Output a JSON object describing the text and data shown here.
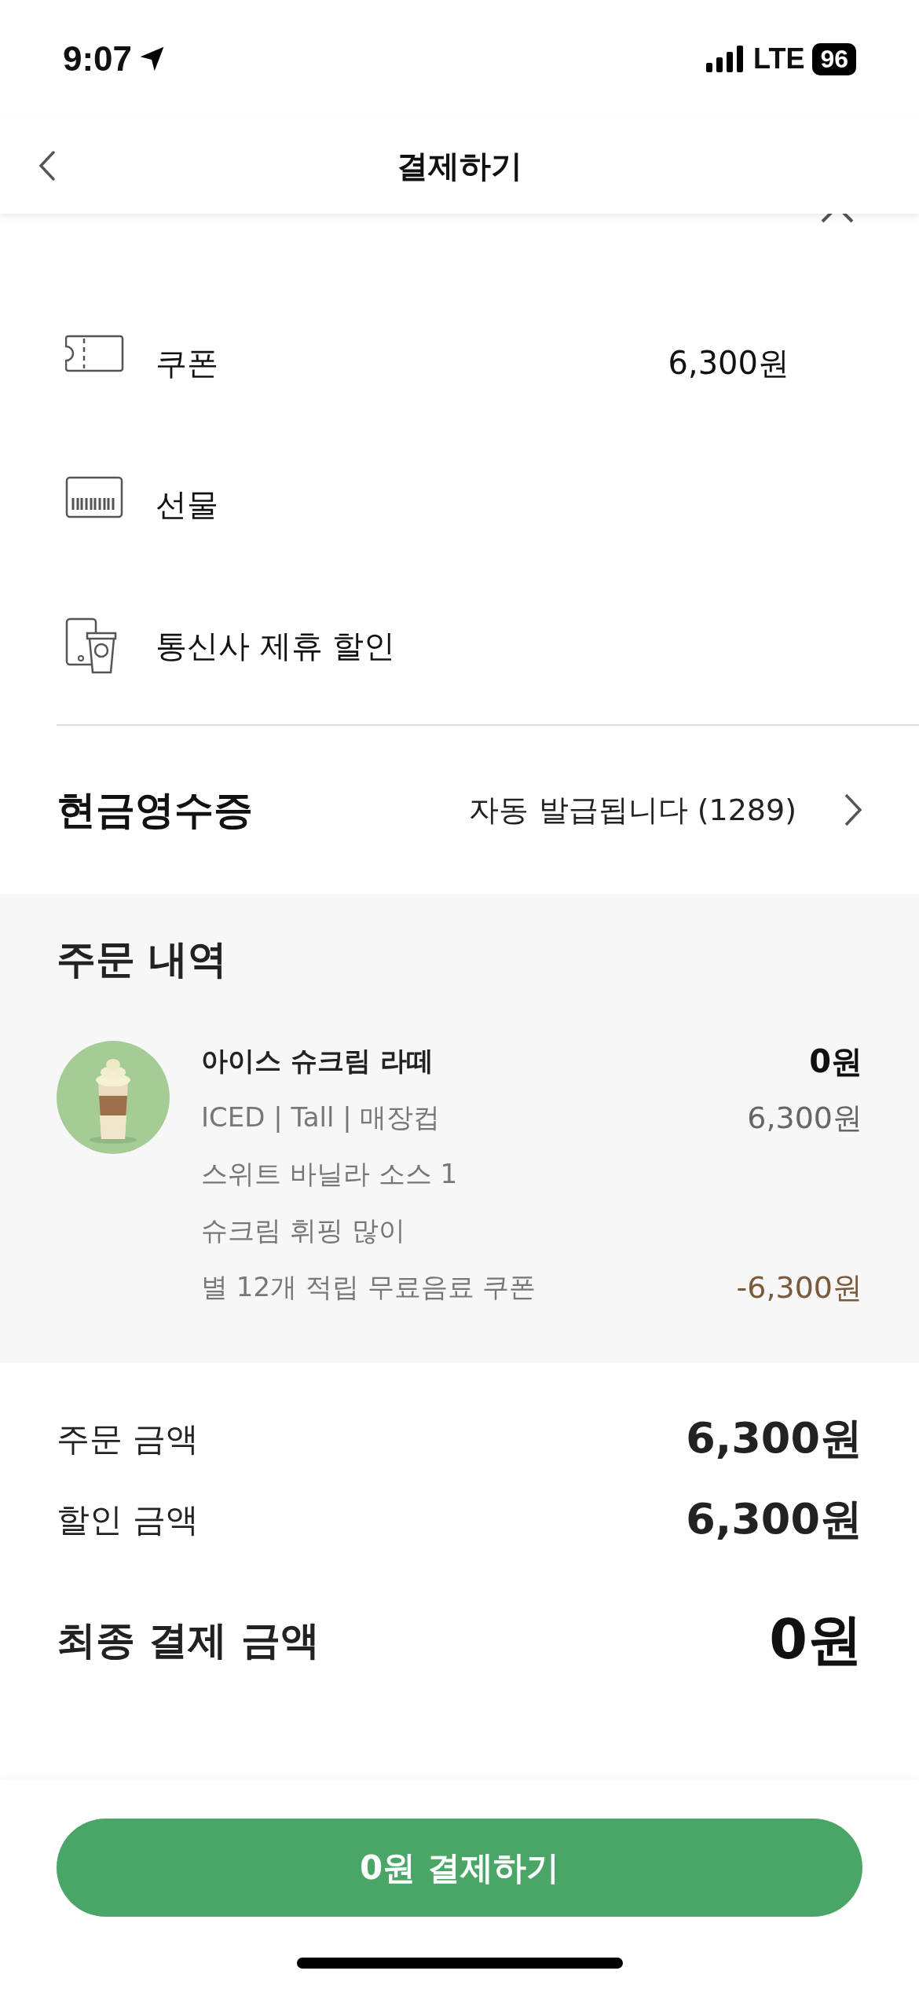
{
  "status_bar": {
    "time": "9:07",
    "network": "LTE",
    "battery": "96"
  },
  "nav": {
    "title": "결제하기"
  },
  "discount_section": {
    "expanded": true,
    "items": [
      {
        "kind": "coupon",
        "label": "쿠폰",
        "value": "6,300원"
      },
      {
        "kind": "gift",
        "label": "선물"
      },
      {
        "kind": "telecom",
        "label": "통신사 제휴 할인"
      }
    ]
  },
  "receipt": {
    "label": "현금영수증",
    "value": "자동 발급됩니다 (1289)"
  },
  "order": {
    "title": "주문 내역",
    "items": [
      {
        "name": "아이스 슈크림 라떼",
        "price": "0원",
        "lines": [
          {
            "text": "ICED | Tall | 매장컵",
            "amount": "6,300원",
            "kind": "normal"
          },
          {
            "text": "스위트 바닐라 소스 1",
            "kind": "normal"
          },
          {
            "text": "슈크림 휘핑 많이",
            "kind": "normal"
          },
          {
            "text": "별 12개 적립 무료음료 쿠폰",
            "amount": "-6,300원",
            "kind": "discount"
          }
        ]
      }
    ]
  },
  "totals": [
    {
      "label": "주문 금액",
      "value": "6,300원",
      "kind": "sub"
    },
    {
      "label": "할인 금액",
      "value": "6,300원",
      "kind": "sub"
    },
    {
      "label": "최종 결제 금액",
      "value": "0원",
      "kind": "final"
    }
  ],
  "pay_button": {
    "label": "0원 결제하기"
  }
}
